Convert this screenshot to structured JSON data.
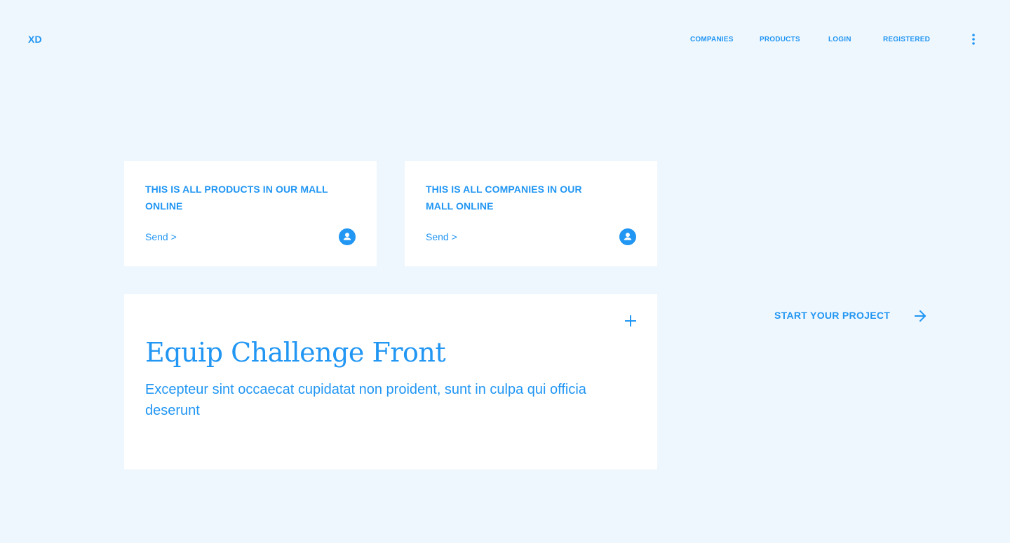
{
  "header": {
    "logo": "XD",
    "nav": [
      {
        "label": "COMPANIES"
      },
      {
        "label": "PRODUCTS"
      },
      {
        "label": "LOGIN"
      },
      {
        "label": "REGISTERED"
      }
    ],
    "menu_icon": "more-vertical-icon"
  },
  "cards": [
    {
      "title": "THIS IS ALL PRODUCTS IN OUR MALL ONLINE",
      "link": "Send >",
      "icon": "user-icon"
    },
    {
      "title": "THIS IS ALL COMPANIES IN OUR MALL ONLINE",
      "link": "Send >",
      "icon": "user-icon"
    }
  ],
  "feature": {
    "title": "Equip Challenge Front",
    "description": "Excepteur sint occaecat cupidatat non proident, sunt in culpa qui officia deserunt",
    "icon": "plus-icon"
  },
  "cta": {
    "label": "START YOUR PROJECT",
    "icon": "arrow-right-icon"
  },
  "colors": {
    "accent": "#2196F3",
    "background": "#EFF7FE",
    "card": "#FFFFFF"
  }
}
